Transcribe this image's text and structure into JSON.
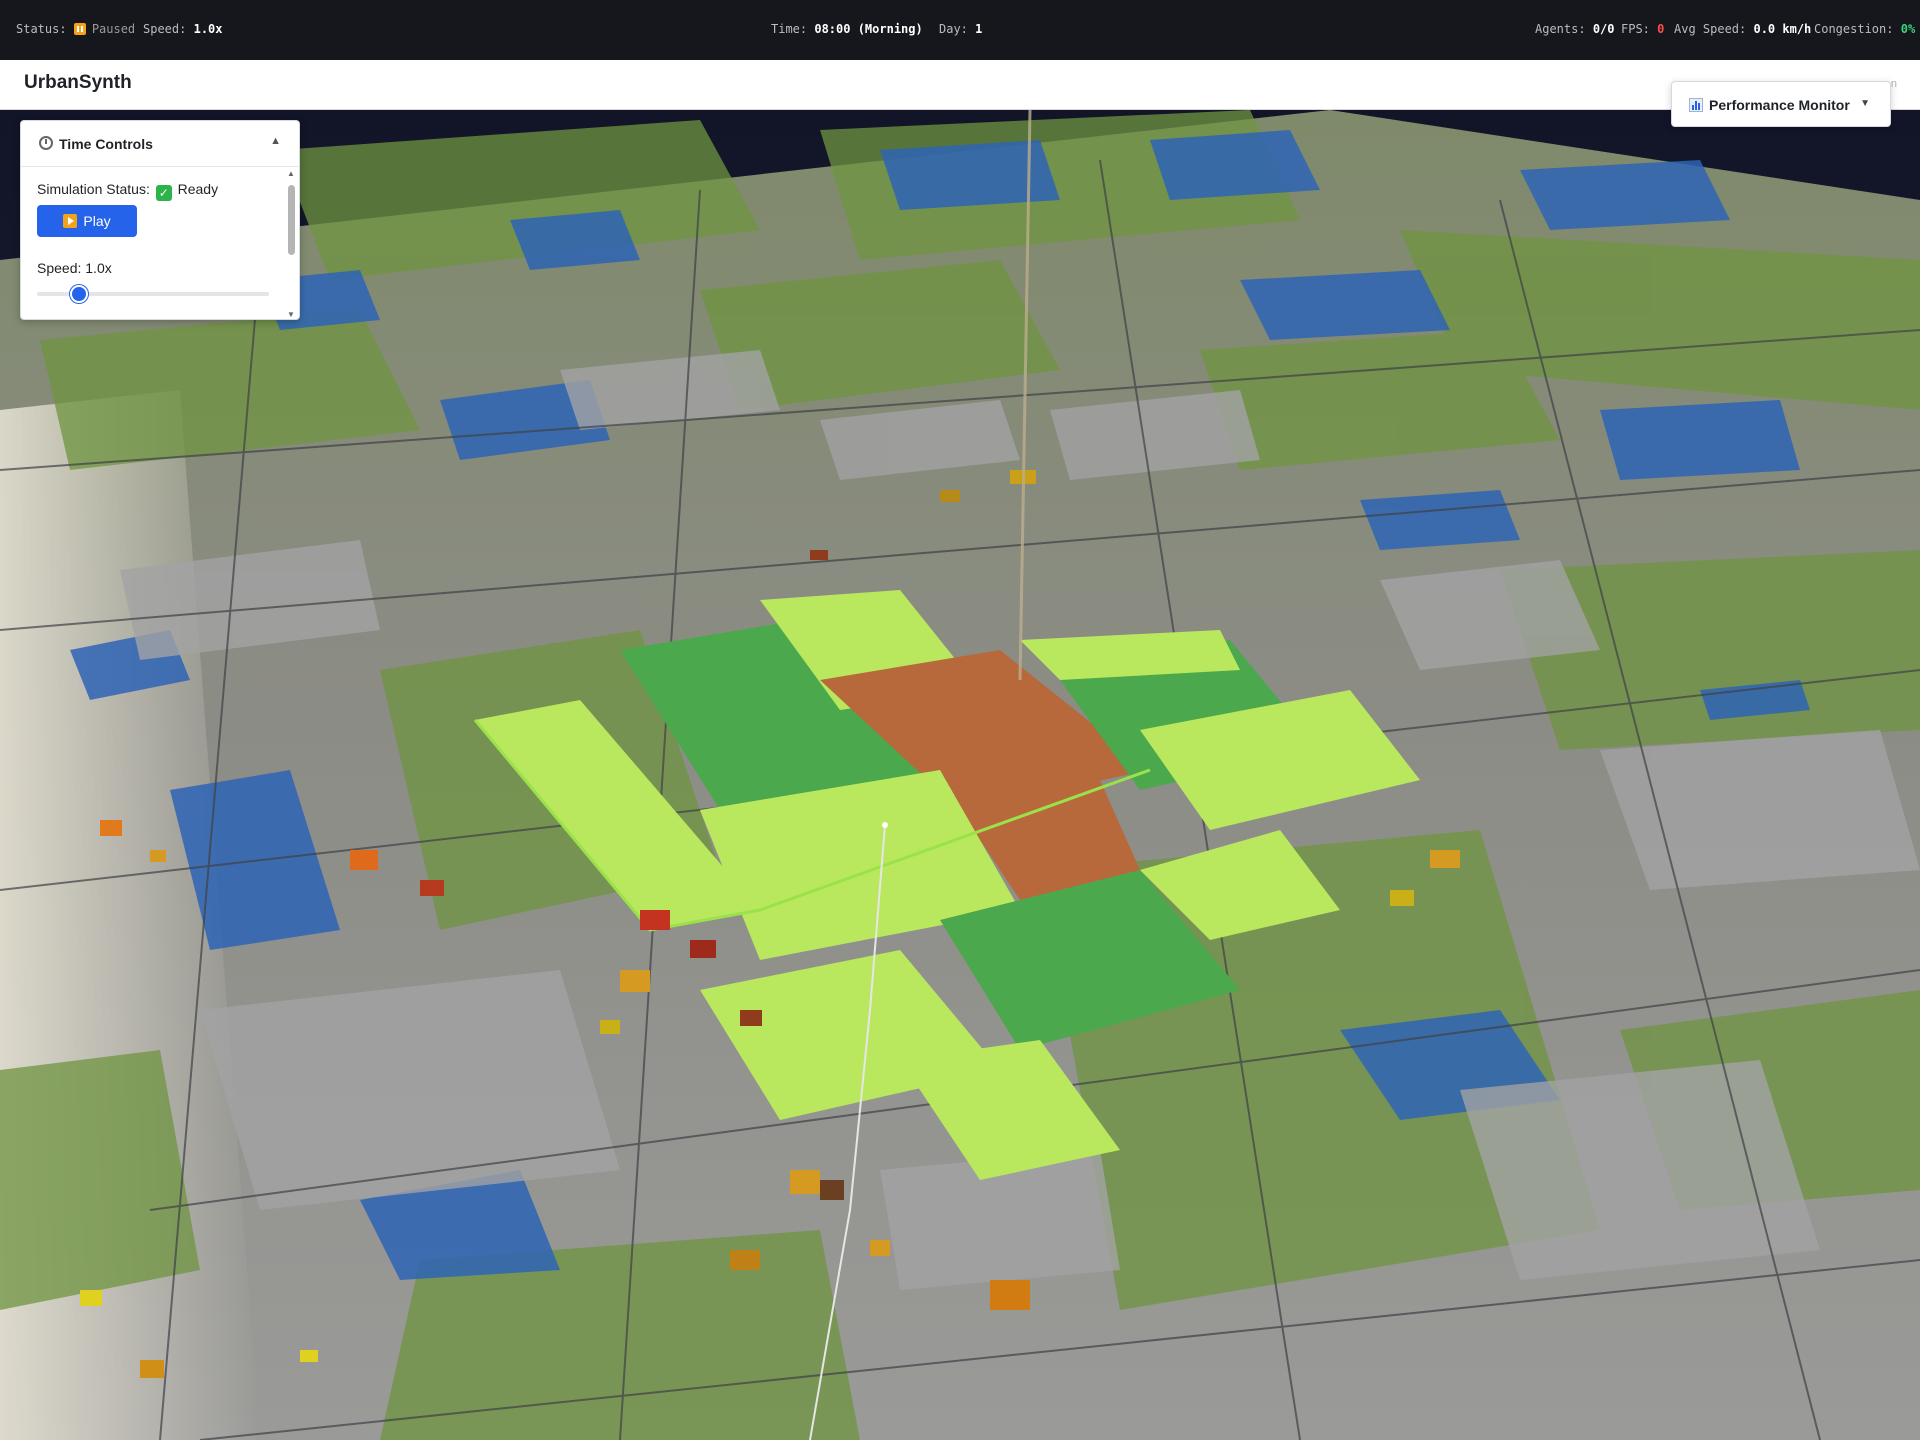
{
  "statusbar": {
    "status_label": "Status:",
    "status_value": "Paused",
    "speed_label": "Speed:",
    "speed_value": "1.0x",
    "time_label": "Time:",
    "time_value": "08:00 (Morning)",
    "day_label": "Day:",
    "day_value": "1",
    "agents_label": "Agents:",
    "agents_value": "0/0",
    "fps_label": "FPS:",
    "fps_value": "0",
    "avgspeed_label": "Avg Speed:",
    "avgspeed_value": "0.0 km/h",
    "congestion_label": "Congestion:",
    "congestion_value": "0%"
  },
  "app": {
    "title": "UrbanSynth",
    "edge_letter": "n"
  },
  "time_controls": {
    "title": "Time Controls",
    "collapse_icon": "chevron-up-icon",
    "status_label": "Simulation Status:",
    "status_value": "Ready",
    "play_label": "Play",
    "speed_label": "Speed: 1.0x",
    "speed_slider_fraction": 0.18
  },
  "performance_monitor": {
    "title": "Performance Monitor",
    "expand_icon": "chevron-down-icon"
  },
  "colors": {
    "accent": "#2563eb",
    "paused": "#f2a31a",
    "fps_red": "#ff4d4d",
    "congestion_green": "#37d67a",
    "ready_green": "#2db34a"
  }
}
